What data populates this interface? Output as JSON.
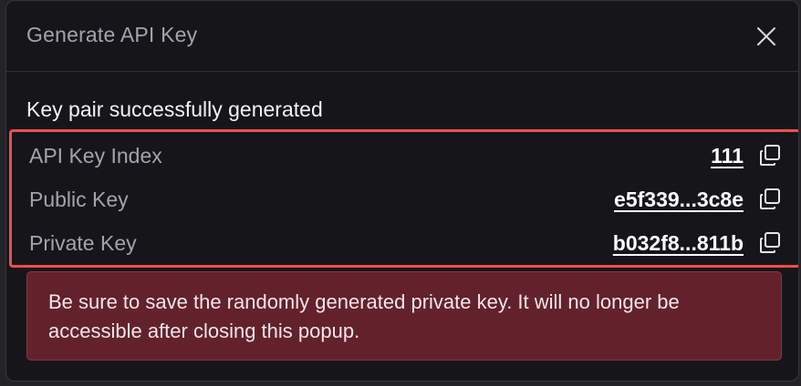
{
  "modal": {
    "title": "Generate API Key",
    "success_message": "Key pair successfully generated",
    "keys": [
      {
        "label": "API Key Index",
        "value": "111"
      },
      {
        "label": "Public Key",
        "value": "e5f339...3c8e"
      },
      {
        "label": "Private Key",
        "value": "b032f8...811b"
      }
    ],
    "warning": "Be sure to save the randomly generated private key. It will no longer be accessible after closing this popup."
  },
  "icons": {
    "close": "close-icon",
    "copy": "copy-icon"
  },
  "colors": {
    "modal_background": "#16161a",
    "highlight_border": "#f04e4e",
    "warning_background": "#63222b",
    "muted_text": "#a3a3ab"
  }
}
